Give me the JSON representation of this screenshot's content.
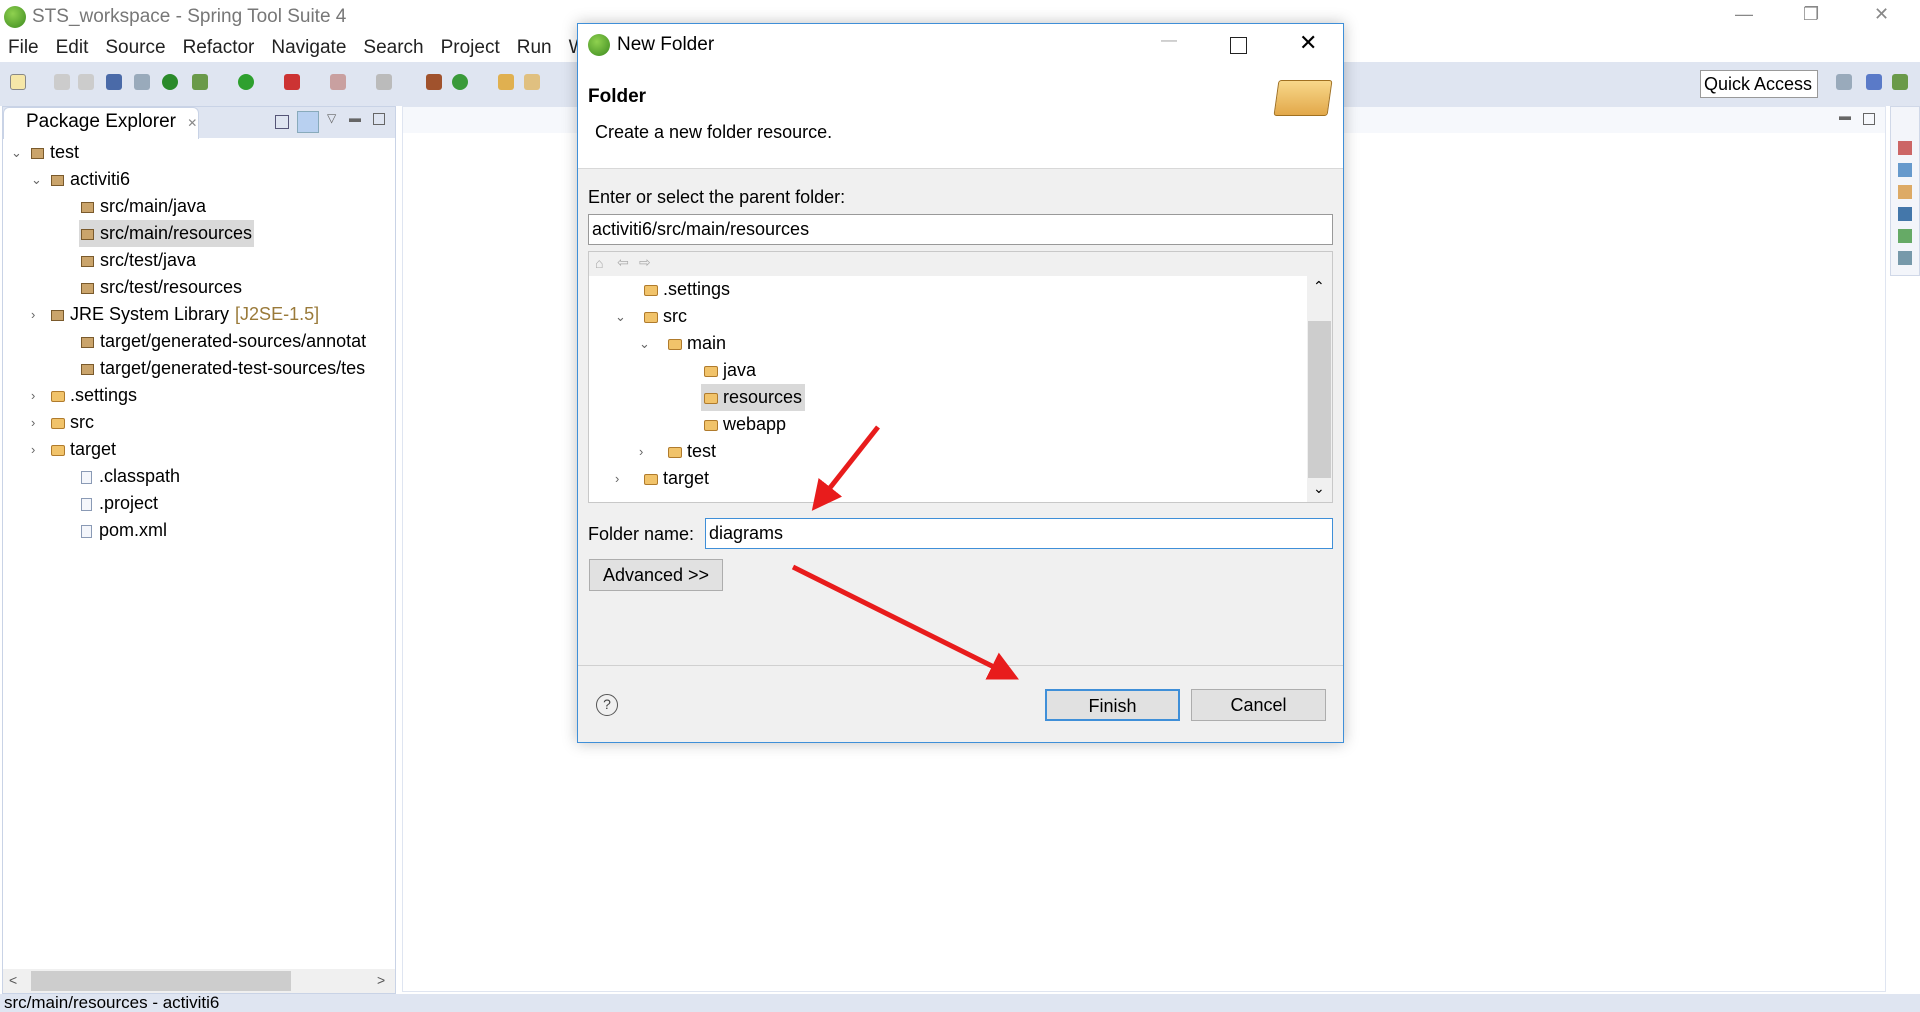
{
  "window": {
    "title": "STS_workspace - Spring Tool Suite 4",
    "minimize": "—",
    "restore": "❐",
    "close": "✕"
  },
  "menu": [
    "File",
    "Edit",
    "Source",
    "Refactor",
    "Navigate",
    "Search",
    "Project",
    "Run",
    "Win"
  ],
  "toolbar": {
    "quick_access": "Quick Access"
  },
  "explorer": {
    "tab_label": "Package Explorer",
    "tab_close": "✕",
    "items": [
      {
        "label": "test",
        "icon": "project-icon",
        "chevron": "expanded"
      },
      {
        "label": "activiti6",
        "icon": "maven-project-icon",
        "chevron": "expanded"
      },
      {
        "label": "src/main/java",
        "icon": "source-folder-icon"
      },
      {
        "label": "src/main/resources",
        "icon": "source-folder-icon",
        "selected": true
      },
      {
        "label": "src/test/java",
        "icon": "source-folder-icon"
      },
      {
        "label": "src/test/resources",
        "icon": "source-folder-icon"
      },
      {
        "label": "JRE System Library",
        "suffix": "[J2SE-1.5]",
        "icon": "library-icon",
        "chevron": "collapsed"
      },
      {
        "label": "target/generated-sources/annotat",
        "icon": "source-folder-icon"
      },
      {
        "label": "target/generated-test-sources/tes",
        "icon": "source-folder-icon"
      },
      {
        "label": ".settings",
        "icon": "folder-icon",
        "chevron": "collapsed"
      },
      {
        "label": "src",
        "icon": "folder-icon",
        "chevron": "collapsed"
      },
      {
        "label": "target",
        "icon": "folder-icon",
        "chevron": "collapsed"
      },
      {
        "label": ".classpath",
        "icon": "file-icon"
      },
      {
        "label": ".project",
        "icon": "file-icon"
      },
      {
        "label": "pom.xml",
        "icon": "xml-file-icon"
      }
    ]
  },
  "status": {
    "text": "src/main/resources - activiti6"
  },
  "dialog": {
    "title": "New Folder",
    "heading": "Folder",
    "description": "Create a new folder resource.",
    "parent_label": "Enter or select the parent folder:",
    "parent_value": "activiti6/src/main/resources",
    "tree": [
      {
        "label": ".settings",
        "depth": 0
      },
      {
        "label": "src",
        "depth": 0,
        "chevron": "expanded"
      },
      {
        "label": "main",
        "depth": 1,
        "chevron": "expanded"
      },
      {
        "label": "java",
        "depth": 2
      },
      {
        "label": "resources",
        "depth": 2,
        "selected": true
      },
      {
        "label": "webapp",
        "depth": 2
      },
      {
        "label": "test",
        "depth": 1,
        "chevron": "collapsed"
      },
      {
        "label": "target",
        "depth": 0,
        "chevron": "collapsed"
      }
    ],
    "folder_name_label": "Folder name:",
    "folder_name_value": "diagrams",
    "advanced_label": "Advanced >>",
    "help": "?",
    "finish_label": "Finish",
    "cancel_label": "Cancel"
  },
  "colors": {
    "accent": "#3f8fd8",
    "annotation_arrow": "#e81c1c",
    "toolbar_bg": "#dfe5f1"
  }
}
